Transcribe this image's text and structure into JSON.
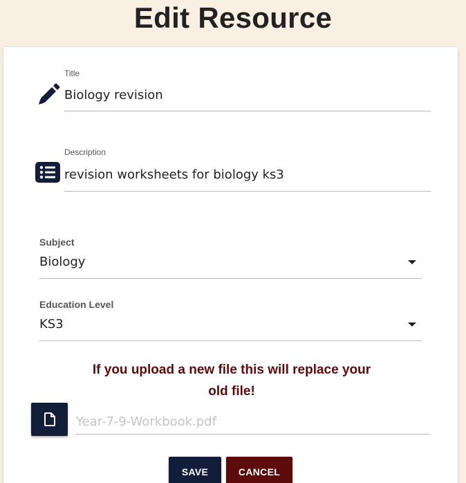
{
  "page": {
    "title": "Edit Resource"
  },
  "form": {
    "title_field": {
      "label": "Title",
      "value": "Biology revision",
      "icon": "pencil-icon"
    },
    "description_field": {
      "label": "Description",
      "value": "revision worksheets for biology ks3",
      "icon": "list-icon"
    },
    "subject_select": {
      "label": "Subject",
      "value": "Biology",
      "icon": "chevron-down-icon"
    },
    "education_level_select": {
      "label": "Education Level",
      "value": "KS3",
      "icon": "chevron-down-icon"
    },
    "upload_warning": "If you upload a new file this will replace your old file!",
    "file_field": {
      "placeholder": "Year-7-9-Workbook.pdf",
      "icon": "file-icon"
    },
    "save_label": "SAVE",
    "cancel_label": "CANCEL"
  },
  "colors": {
    "background": "#f9efe2",
    "primary": "#121d3a",
    "danger": "#5c0a0a"
  }
}
